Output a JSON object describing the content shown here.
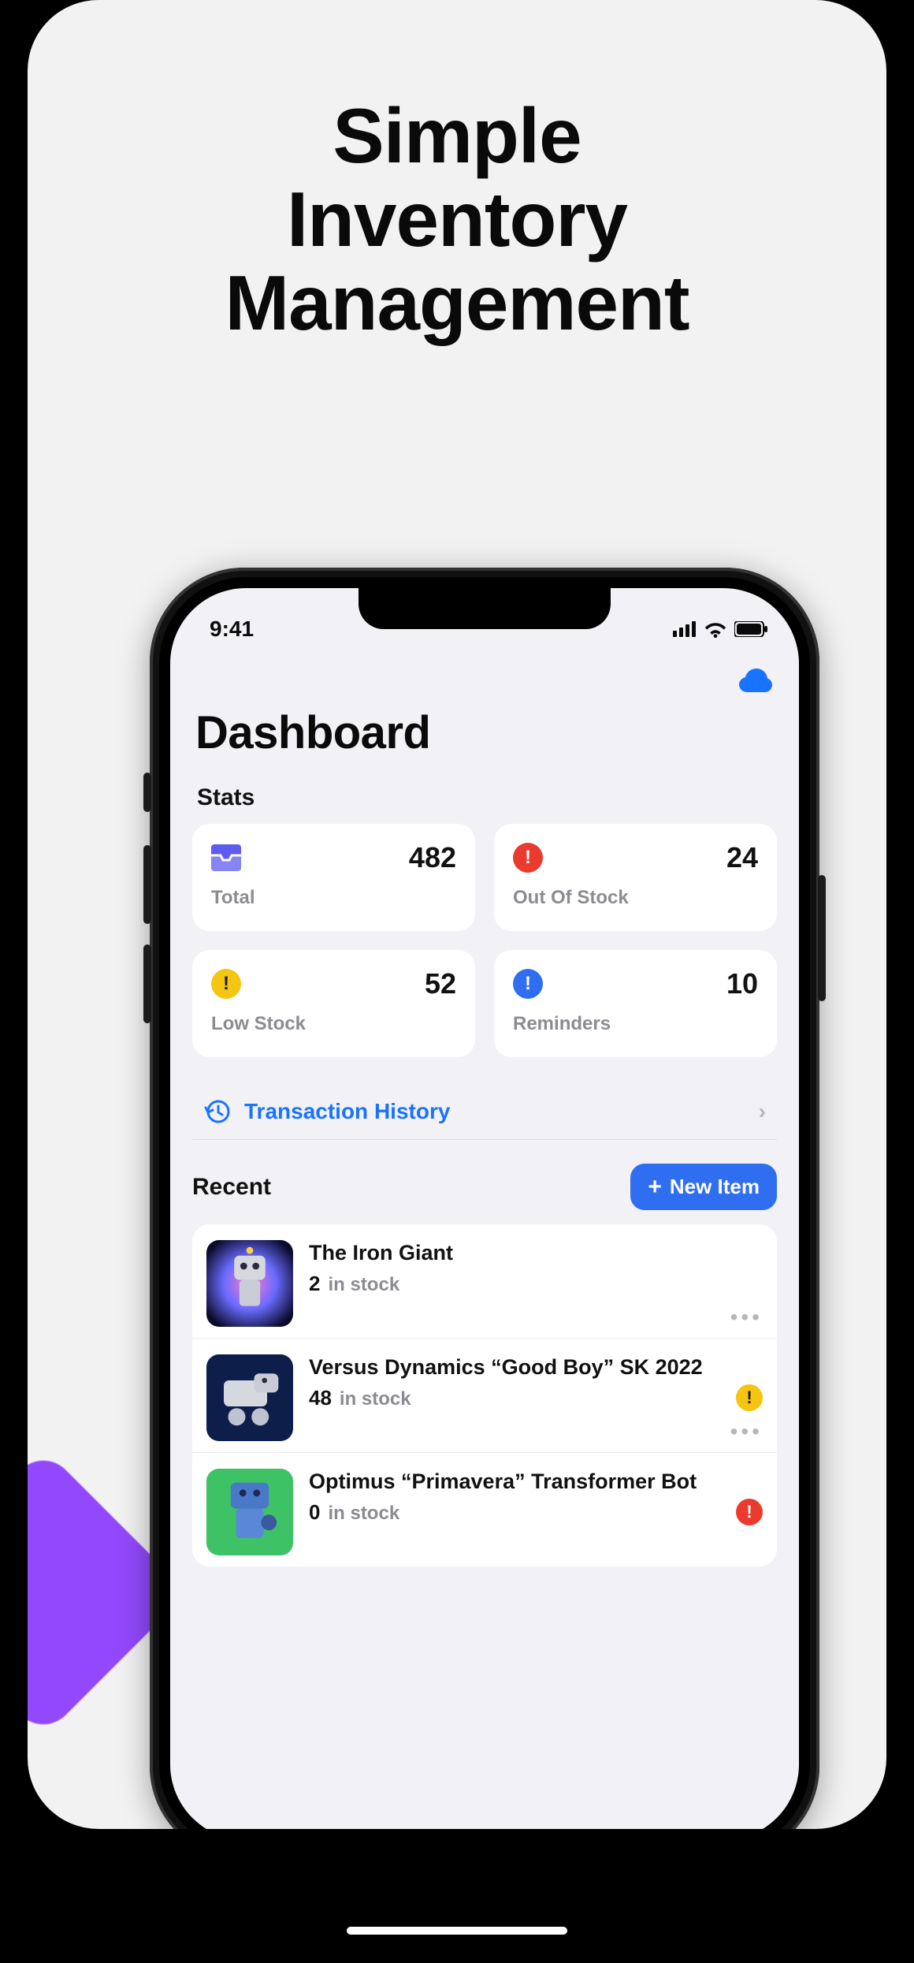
{
  "promo": {
    "headline_l1": "Simple",
    "headline_l2": "Inventory",
    "headline_l3": "Management"
  },
  "status": {
    "time": "9:41"
  },
  "header": {
    "title": "Dashboard"
  },
  "stats": {
    "section_label": "Stats",
    "total": {
      "value": "482",
      "label": "Total"
    },
    "out_of_stock": {
      "value": "24",
      "label": "Out Of Stock"
    },
    "low_stock": {
      "value": "52",
      "label": "Low Stock"
    },
    "reminders": {
      "value": "10",
      "label": "Reminders"
    }
  },
  "transactions": {
    "label": "Transaction History"
  },
  "recent": {
    "section_label": "Recent",
    "new_button_label": "New Item",
    "in_stock_label": "in stock",
    "items": [
      {
        "title": "The Iron Giant",
        "qty": "2",
        "badge": "none"
      },
      {
        "title": "Versus Dynamics “Good Boy” SK 2022",
        "qty": "48",
        "badge": "low"
      },
      {
        "title": "Optimus “Primavera” Transformer Bot",
        "qty": "0",
        "badge": "out"
      }
    ]
  }
}
